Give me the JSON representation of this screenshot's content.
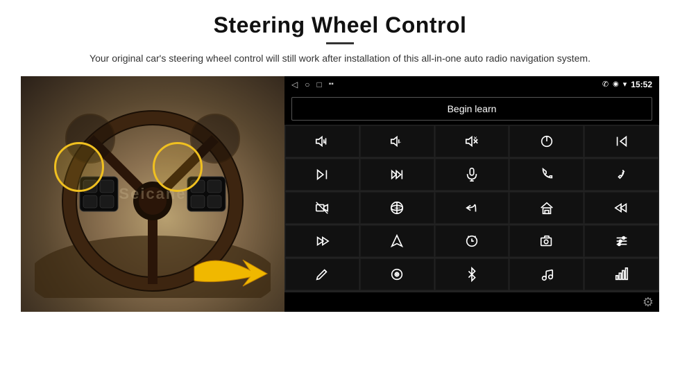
{
  "header": {
    "title": "Steering Wheel Control",
    "divider": true,
    "subtitle": "Your original car's steering wheel control will still work after installation of this all-in-one auto radio navigation system."
  },
  "android_ui": {
    "status_bar": {
      "nav_back": "◁",
      "nav_home": "○",
      "nav_square": "□",
      "signal_icon": "▪▪",
      "phone_icon": "✆",
      "location_icon": "◉",
      "wifi_icon": "▾",
      "time": "15:52"
    },
    "begin_learn_label": "Begin learn",
    "settings_label": "⚙"
  },
  "controls": [
    {
      "icon": "vol-up",
      "unicode": "🔊+"
    },
    {
      "icon": "vol-down",
      "unicode": "🔉−"
    },
    {
      "icon": "mute",
      "unicode": "🔇"
    },
    {
      "icon": "power",
      "unicode": "⏻"
    },
    {
      "icon": "prev-track",
      "unicode": "⏮"
    },
    {
      "icon": "skip-next",
      "unicode": "⏭"
    },
    {
      "icon": "fast-forward-skip",
      "unicode": "⏭✂"
    },
    {
      "icon": "mic",
      "unicode": "🎤"
    },
    {
      "icon": "phone",
      "unicode": "📞"
    },
    {
      "icon": "hang-up",
      "unicode": "📵"
    },
    {
      "icon": "mute-speaker",
      "unicode": "🔇"
    },
    {
      "icon": "360-view",
      "unicode": "360°"
    },
    {
      "icon": "back",
      "unicode": "↩"
    },
    {
      "icon": "home",
      "unicode": "⌂"
    },
    {
      "icon": "skip-prev",
      "unicode": "⏮"
    },
    {
      "icon": "fast-next",
      "unicode": "⏭"
    },
    {
      "icon": "navigate",
      "unicode": "➤"
    },
    {
      "icon": "source",
      "unicode": "⇄"
    },
    {
      "icon": "camera",
      "unicode": "📷"
    },
    {
      "icon": "equalizer",
      "unicode": "🎚"
    },
    {
      "icon": "pen",
      "unicode": "✏"
    },
    {
      "icon": "radio",
      "unicode": "📻"
    },
    {
      "icon": "bluetooth",
      "unicode": "🔵"
    },
    {
      "icon": "music",
      "unicode": "♫"
    },
    {
      "icon": "spectrum",
      "unicode": "📶"
    }
  ]
}
